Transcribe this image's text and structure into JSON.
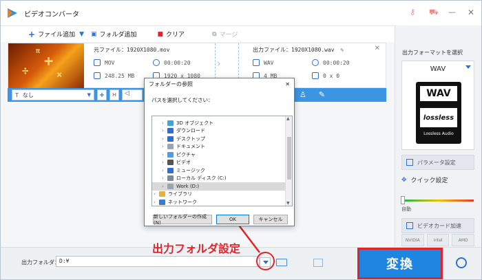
{
  "window": {
    "title": "ビデオコンバータ"
  },
  "toolbar": {
    "add_file": "ファイル追加",
    "add_folder": "フォルダ追加",
    "clear": "クリア",
    "merge": "マージ"
  },
  "file": {
    "source_name": "元ファイル：1920X1080.mov",
    "source_format": "MOV",
    "source_duration": "00:00:20",
    "source_size": "248.25 MB",
    "source_resolution": "1920 x 1080",
    "output_name": "出力ファイル：1920X1080.wav",
    "output_format": "WAV",
    "output_duration": "00:00:20",
    "output_size": "4 MB",
    "output_resolution": "0 x 0"
  },
  "subtitle_bar": {
    "subtitle_value": "なし",
    "audio_value": ""
  },
  "right_panel": {
    "title": "出力フォーマットを選択",
    "format": "WAV",
    "card_wav": "WAV",
    "card_lossless": "lossless",
    "card_caption": "Lossless Audio",
    "param_button": "パラメータ設定",
    "quick_setting": "クイック設定",
    "auto_label": "自動",
    "gpu_button": "ビデオカード加速",
    "gpu_vendors": [
      "NVIDIA",
      "intel",
      "AMD"
    ]
  },
  "bottom": {
    "output_folder_label": "出力フォルダ：",
    "output_folder_value": "D:¥",
    "convert_label": "変換"
  },
  "annotation": {
    "text": "出力フォルダ設定"
  },
  "dialog": {
    "title": "フォルダーの参照",
    "prompt": "パスを選択してください：",
    "items": [
      {
        "label": "3D オブジェクト",
        "color": "#3aa6e0"
      },
      {
        "label": "ダウンロード",
        "color": "#2f6fd0"
      },
      {
        "label": "デスクトップ",
        "color": "#2f6fd0"
      },
      {
        "label": "ドキュメント",
        "color": "#9aa5b1"
      },
      {
        "label": "ピクチャ",
        "color": "#4aa0e0"
      },
      {
        "label": "ビデオ",
        "color": "#555555"
      },
      {
        "label": "ミュージック",
        "color": "#2f6fd0"
      },
      {
        "label": "ローカル ディスク (C:)",
        "color": "#7a8a99"
      },
      {
        "label": "Work (D:)",
        "color": "#9aa5b1"
      },
      {
        "label": "ライブラリ",
        "color": "#e6b23a"
      },
      {
        "label": "ネットワーク",
        "color": "#3a7ad0"
      }
    ],
    "new_folder_button": "新しいフォルダーの作成(N)",
    "ok_button": "OK",
    "cancel_button": "キャンセル",
    "close": "✕"
  }
}
